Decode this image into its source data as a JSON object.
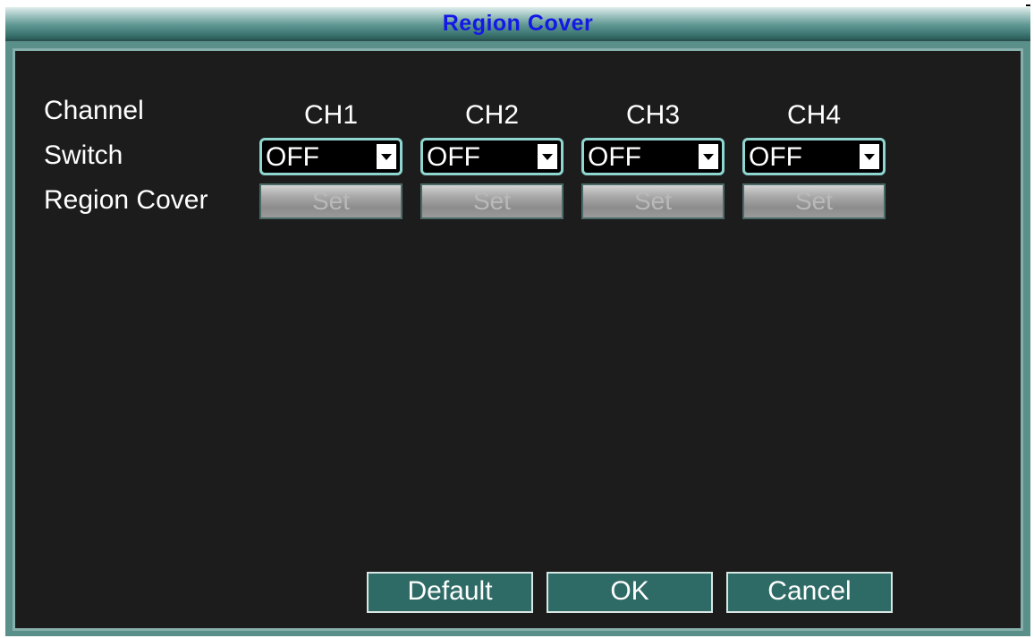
{
  "dialog": {
    "title": "Region Cover"
  },
  "rows": {
    "channel_label": "Channel",
    "switch_label": "Switch",
    "region_cover_label": "Region Cover"
  },
  "channels": [
    {
      "name": "CH1",
      "switch_value": "OFF",
      "set_label": "Set"
    },
    {
      "name": "CH2",
      "switch_value": "OFF",
      "set_label": "Set"
    },
    {
      "name": "CH3",
      "switch_value": "OFF",
      "set_label": "Set"
    },
    {
      "name": "CH4",
      "switch_value": "OFF",
      "set_label": "Set"
    }
  ],
  "buttons": {
    "default_label": "Default",
    "ok_label": "OK",
    "cancel_label": "Cancel"
  },
  "colors": {
    "title_text": "#1418e6",
    "frame": "#5a8f8a",
    "content_bg": "#1c1c1c",
    "button_bg": "#2f6b66",
    "select_border": "#8fd6d0"
  },
  "icons": {
    "dropdown": "chevron-down-icon"
  }
}
